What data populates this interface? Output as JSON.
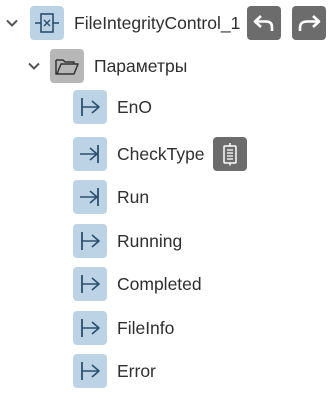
{
  "tree": {
    "root": {
      "label": "FileIntegrityControl_1",
      "icon": "function-block-icon",
      "expanded": true
    },
    "toolbar": {
      "undo_icon": "undo-icon",
      "redo_icon": "redo-icon"
    },
    "folder": {
      "label": "Параметры",
      "icon": "folder-icon",
      "expanded": true
    },
    "params": [
      {
        "label": "EnO",
        "icon": "output-pin-icon"
      },
      {
        "label": "CheckType",
        "icon": "input-pin-icon",
        "badge": "list-icon"
      },
      {
        "label": "Run",
        "icon": "input-pin-icon"
      },
      {
        "label": "Running",
        "icon": "output-pin-icon"
      },
      {
        "label": "Completed",
        "icon": "output-pin-icon"
      },
      {
        "label": "FileInfo",
        "icon": "output-pin-icon"
      },
      {
        "label": "Error",
        "icon": "output-pin-icon"
      }
    ]
  },
  "colors": {
    "pin_icon_bg": "#bcd3e5",
    "pin_icon_stroke": "#2d4f6e",
    "folder_bg": "#b7b7b7",
    "button_bg": "#6c6c6c",
    "text": "#2f2f2f"
  }
}
